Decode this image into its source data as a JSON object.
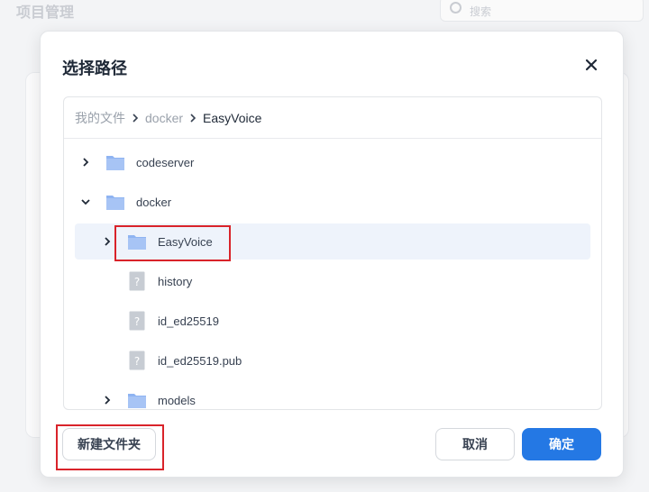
{
  "background": {
    "title": "项目管理",
    "search_placeholder": "搜索"
  },
  "dialog": {
    "title": "选择路径",
    "breadcrumb": [
      {
        "label": "我的文件",
        "current": false
      },
      {
        "label": "docker",
        "current": false
      },
      {
        "label": "EasyVoice",
        "current": true
      }
    ],
    "tree": [
      {
        "label": "codeserver",
        "type": "folder",
        "depth": 0,
        "expanded": false,
        "has_toggle": true
      },
      {
        "label": "docker",
        "type": "folder",
        "depth": 0,
        "expanded": true,
        "has_toggle": true
      },
      {
        "label": "EasyVoice",
        "type": "folder",
        "depth": 1,
        "expanded": false,
        "has_toggle": true,
        "selected": true
      },
      {
        "label": "history",
        "type": "file",
        "depth": 1,
        "has_toggle": false
      },
      {
        "label": "id_ed25519",
        "type": "file",
        "depth": 1,
        "has_toggle": false
      },
      {
        "label": "id_ed25519.pub",
        "type": "file",
        "depth": 1,
        "has_toggle": false
      },
      {
        "label": "models",
        "type": "folder",
        "depth": 1,
        "expanded": false,
        "has_toggle": true
      }
    ],
    "buttons": {
      "new_folder": "新建文件夹",
      "cancel": "取消",
      "confirm": "确定"
    }
  },
  "colors": {
    "accent": "#2478e4",
    "folder": "#8fb4f2",
    "selected_row": "#eef3fb",
    "highlight": "#d9232a"
  }
}
